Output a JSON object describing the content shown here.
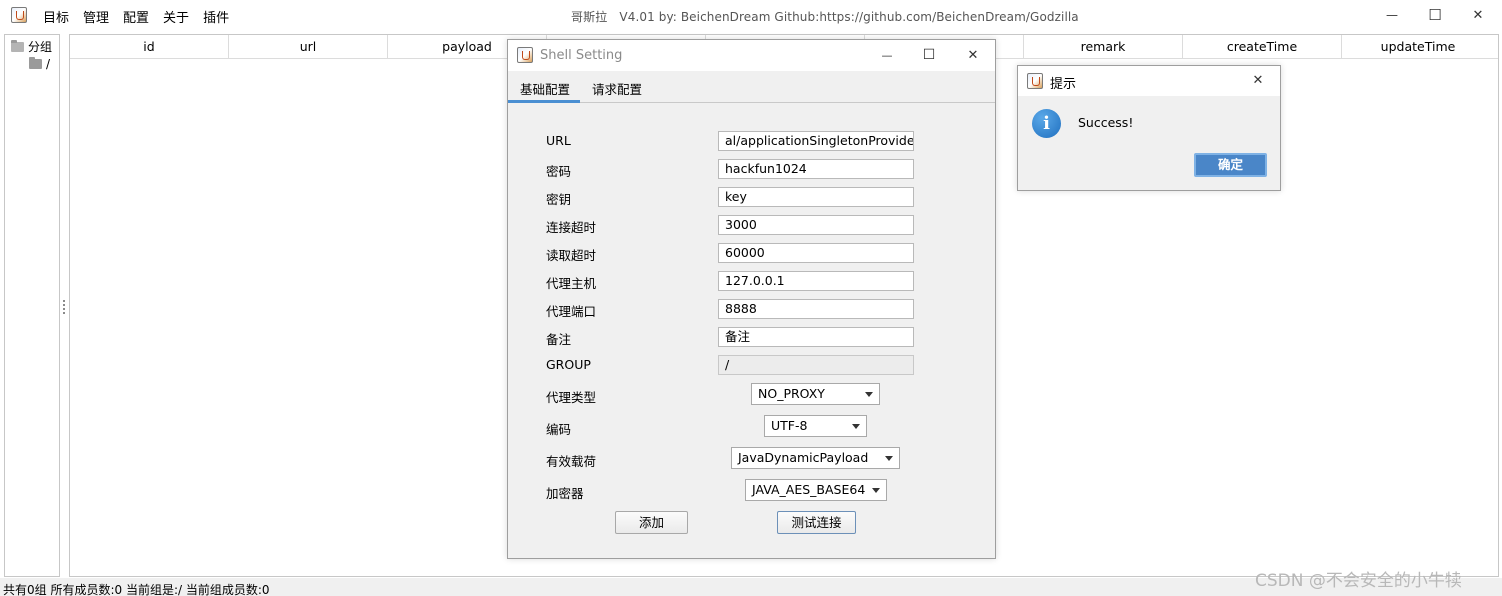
{
  "window": {
    "title": "哥斯拉　V4.01 by: BeichenDream Github:https://github.com/BeichenDream/Godzilla",
    "minimize": "—",
    "maximize": "☐",
    "close": "✕"
  },
  "menu": [
    "目标",
    "管理",
    "配置",
    "关于",
    "插件"
  ],
  "tree": {
    "root": "分组",
    "child": "/"
  },
  "table": {
    "columns": [
      "id",
      "url",
      "payload",
      "",
      "",
      "",
      "remark",
      "createTime",
      "updateTime"
    ]
  },
  "status": {
    "text": "共有0组 所有成员数:0 当前组是:/ 当前组成员数:0"
  },
  "watermark": "CSDN @不会安全的小牛犊",
  "shell_dialog": {
    "title": "Shell Setting",
    "tabs": [
      "基础配置",
      "请求配置"
    ],
    "fields": [
      {
        "label": "URL",
        "value": "al/applicationSingletonProvider"
      },
      {
        "label": "密码",
        "value": "hackfun1024"
      },
      {
        "label": "密钥",
        "value": "key"
      },
      {
        "label": "连接超时",
        "value": "3000"
      },
      {
        "label": "读取超时",
        "value": "60000"
      },
      {
        "label": "代理主机",
        "value": "127.0.0.1"
      },
      {
        "label": "代理端口",
        "value": "8888"
      },
      {
        "label": "备注",
        "value": "备注"
      },
      {
        "label": "GROUP",
        "value": "/"
      }
    ],
    "selects": [
      {
        "label": "代理类型",
        "value": "NO_PROXY"
      },
      {
        "label": "编码",
        "value": "UTF-8"
      },
      {
        "label": "有效载荷",
        "value": "JavaDynamicPayload"
      },
      {
        "label": "加密器",
        "value": "JAVA_AES_BASE64"
      }
    ],
    "add_button": "添加",
    "test_button": "测试连接"
  },
  "message_dialog": {
    "title": "提示",
    "message": "Success!",
    "ok": "确定",
    "close": "✕"
  }
}
